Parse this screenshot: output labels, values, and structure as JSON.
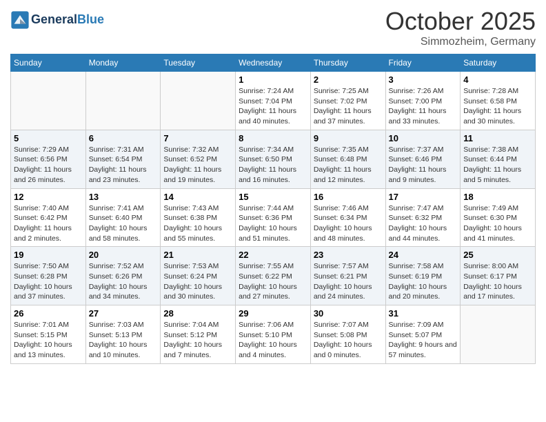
{
  "header": {
    "logo_line1": "General",
    "logo_line2": "Blue",
    "month": "October 2025",
    "location": "Simmozheim, Germany"
  },
  "weekdays": [
    "Sunday",
    "Monday",
    "Tuesday",
    "Wednesday",
    "Thursday",
    "Friday",
    "Saturday"
  ],
  "weeks": [
    [
      {
        "day": "",
        "info": ""
      },
      {
        "day": "",
        "info": ""
      },
      {
        "day": "",
        "info": ""
      },
      {
        "day": "1",
        "info": "Sunrise: 7:24 AM\nSunset: 7:04 PM\nDaylight: 11 hours and 40 minutes."
      },
      {
        "day": "2",
        "info": "Sunrise: 7:25 AM\nSunset: 7:02 PM\nDaylight: 11 hours and 37 minutes."
      },
      {
        "day": "3",
        "info": "Sunrise: 7:26 AM\nSunset: 7:00 PM\nDaylight: 11 hours and 33 minutes."
      },
      {
        "day": "4",
        "info": "Sunrise: 7:28 AM\nSunset: 6:58 PM\nDaylight: 11 hours and 30 minutes."
      }
    ],
    [
      {
        "day": "5",
        "info": "Sunrise: 7:29 AM\nSunset: 6:56 PM\nDaylight: 11 hours and 26 minutes."
      },
      {
        "day": "6",
        "info": "Sunrise: 7:31 AM\nSunset: 6:54 PM\nDaylight: 11 hours and 23 minutes."
      },
      {
        "day": "7",
        "info": "Sunrise: 7:32 AM\nSunset: 6:52 PM\nDaylight: 11 hours and 19 minutes."
      },
      {
        "day": "8",
        "info": "Sunrise: 7:34 AM\nSunset: 6:50 PM\nDaylight: 11 hours and 16 minutes."
      },
      {
        "day": "9",
        "info": "Sunrise: 7:35 AM\nSunset: 6:48 PM\nDaylight: 11 hours and 12 minutes."
      },
      {
        "day": "10",
        "info": "Sunrise: 7:37 AM\nSunset: 6:46 PM\nDaylight: 11 hours and 9 minutes."
      },
      {
        "day": "11",
        "info": "Sunrise: 7:38 AM\nSunset: 6:44 PM\nDaylight: 11 hours and 5 minutes."
      }
    ],
    [
      {
        "day": "12",
        "info": "Sunrise: 7:40 AM\nSunset: 6:42 PM\nDaylight: 11 hours and 2 minutes."
      },
      {
        "day": "13",
        "info": "Sunrise: 7:41 AM\nSunset: 6:40 PM\nDaylight: 10 hours and 58 minutes."
      },
      {
        "day": "14",
        "info": "Sunrise: 7:43 AM\nSunset: 6:38 PM\nDaylight: 10 hours and 55 minutes."
      },
      {
        "day": "15",
        "info": "Sunrise: 7:44 AM\nSunset: 6:36 PM\nDaylight: 10 hours and 51 minutes."
      },
      {
        "day": "16",
        "info": "Sunrise: 7:46 AM\nSunset: 6:34 PM\nDaylight: 10 hours and 48 minutes."
      },
      {
        "day": "17",
        "info": "Sunrise: 7:47 AM\nSunset: 6:32 PM\nDaylight: 10 hours and 44 minutes."
      },
      {
        "day": "18",
        "info": "Sunrise: 7:49 AM\nSunset: 6:30 PM\nDaylight: 10 hours and 41 minutes."
      }
    ],
    [
      {
        "day": "19",
        "info": "Sunrise: 7:50 AM\nSunset: 6:28 PM\nDaylight: 10 hours and 37 minutes."
      },
      {
        "day": "20",
        "info": "Sunrise: 7:52 AM\nSunset: 6:26 PM\nDaylight: 10 hours and 34 minutes."
      },
      {
        "day": "21",
        "info": "Sunrise: 7:53 AM\nSunset: 6:24 PM\nDaylight: 10 hours and 30 minutes."
      },
      {
        "day": "22",
        "info": "Sunrise: 7:55 AM\nSunset: 6:22 PM\nDaylight: 10 hours and 27 minutes."
      },
      {
        "day": "23",
        "info": "Sunrise: 7:57 AM\nSunset: 6:21 PM\nDaylight: 10 hours and 24 minutes."
      },
      {
        "day": "24",
        "info": "Sunrise: 7:58 AM\nSunset: 6:19 PM\nDaylight: 10 hours and 20 minutes."
      },
      {
        "day": "25",
        "info": "Sunrise: 8:00 AM\nSunset: 6:17 PM\nDaylight: 10 hours and 17 minutes."
      }
    ],
    [
      {
        "day": "26",
        "info": "Sunrise: 7:01 AM\nSunset: 5:15 PM\nDaylight: 10 hours and 13 minutes."
      },
      {
        "day": "27",
        "info": "Sunrise: 7:03 AM\nSunset: 5:13 PM\nDaylight: 10 hours and 10 minutes."
      },
      {
        "day": "28",
        "info": "Sunrise: 7:04 AM\nSunset: 5:12 PM\nDaylight: 10 hours and 7 minutes."
      },
      {
        "day": "29",
        "info": "Sunrise: 7:06 AM\nSunset: 5:10 PM\nDaylight: 10 hours and 4 minutes."
      },
      {
        "day": "30",
        "info": "Sunrise: 7:07 AM\nSunset: 5:08 PM\nDaylight: 10 hours and 0 minutes."
      },
      {
        "day": "31",
        "info": "Sunrise: 7:09 AM\nSunset: 5:07 PM\nDaylight: 9 hours and 57 minutes."
      },
      {
        "day": "",
        "info": ""
      }
    ]
  ]
}
